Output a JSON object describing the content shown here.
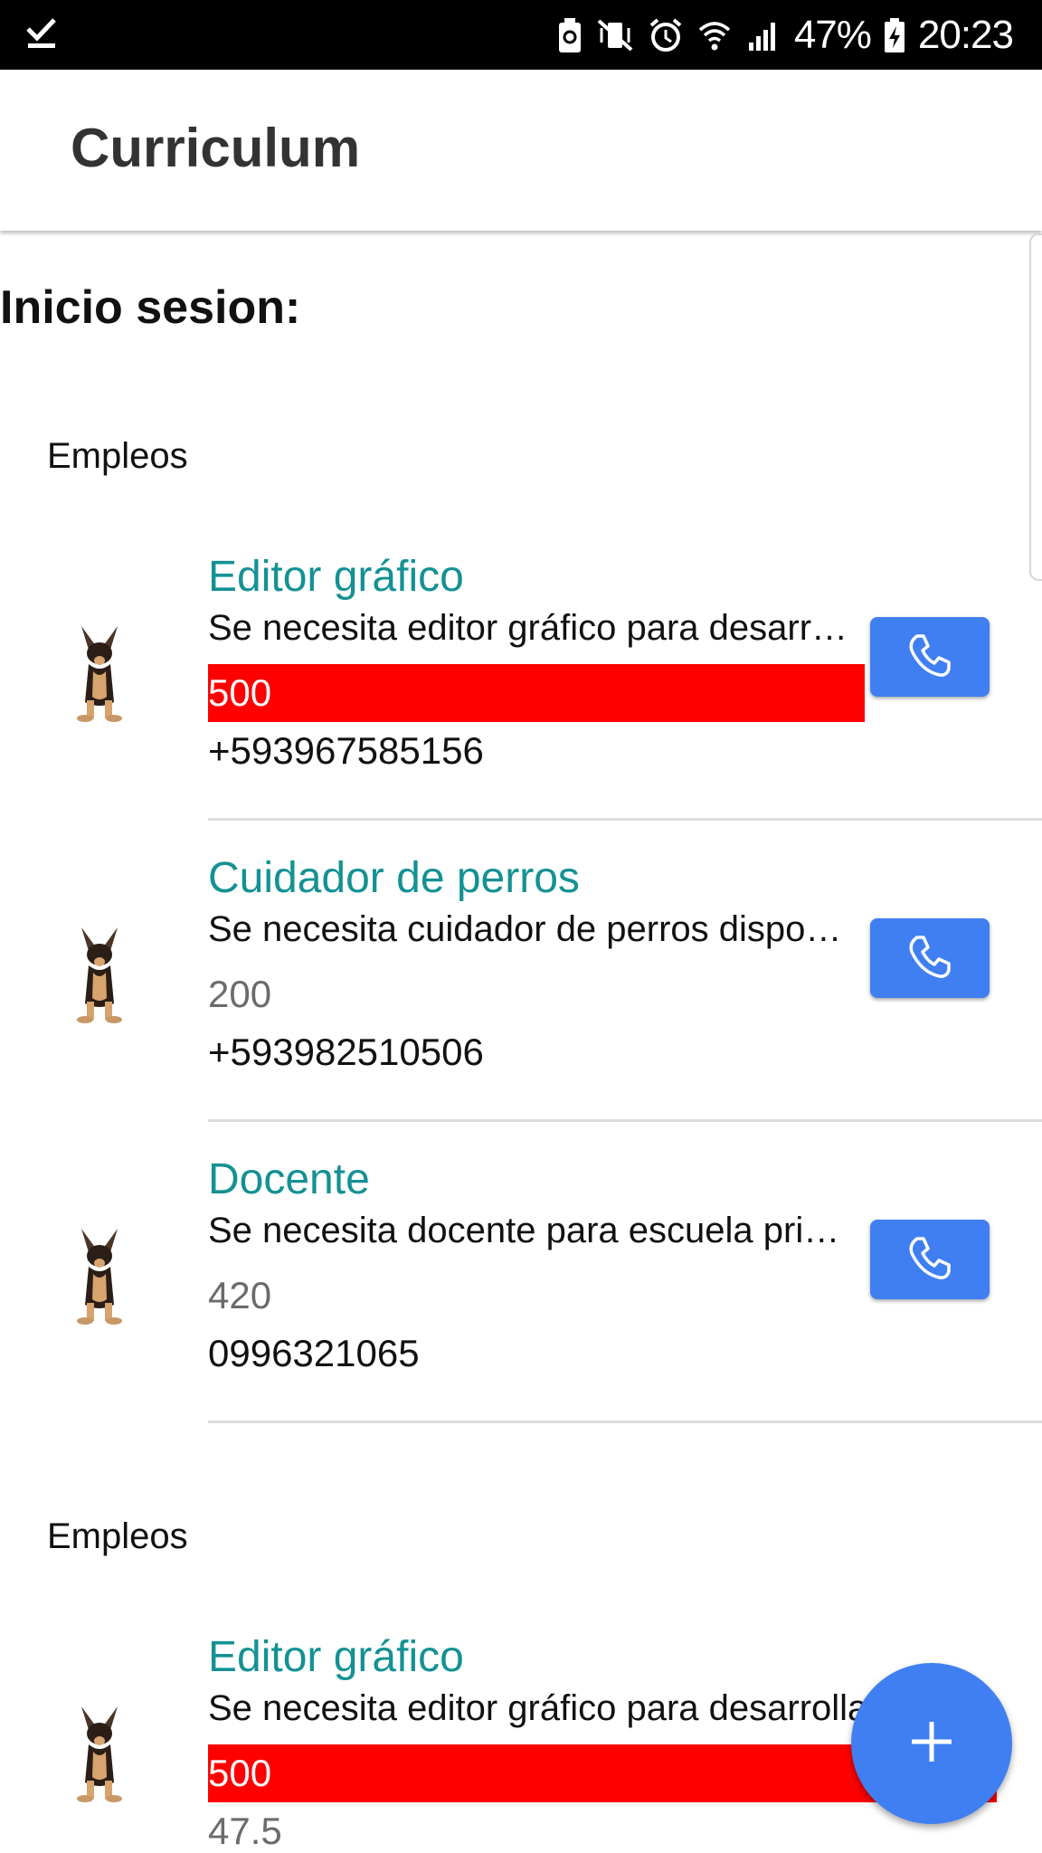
{
  "status_bar": {
    "battery": "47%",
    "time": "20:23",
    "icons": [
      "check-icon",
      "battery-saver-icon",
      "mute-vibrate-icon",
      "alarm-icon",
      "wifi-icon",
      "signal-icon",
      "battery-charging-icon"
    ]
  },
  "app_bar": {
    "title": "Curriculum"
  },
  "page": {
    "heading": "Inicio sesion:"
  },
  "groups": [
    {
      "label": "Empleos",
      "items": [
        {
          "title": "Editor gráfico",
          "description": "Se necesita editor gráfico para desarrollar",
          "salary": "500",
          "phone": "+593967585156",
          "highlighted": true
        },
        {
          "title": "Cuidador de perros",
          "description": "Se necesita cuidador de perros disponible",
          "salary": "200",
          "phone": "+593982510506",
          "highlighted": false
        },
        {
          "title": "Docente",
          "description": "Se necesita docente para escuela primaria",
          "salary": "420",
          "phone": "0996321065",
          "highlighted": false
        }
      ]
    },
    {
      "label": "Empleos",
      "items": [
        {
          "title": "Editor gráfico",
          "description": "Se necesita editor gráfico para desarrollar",
          "salary": "500",
          "phone": "47.5",
          "highlighted": true
        }
      ]
    }
  ],
  "colors": {
    "accent": "#3f7ff1",
    "title": "#149193",
    "highlight": "#ff0000"
  }
}
